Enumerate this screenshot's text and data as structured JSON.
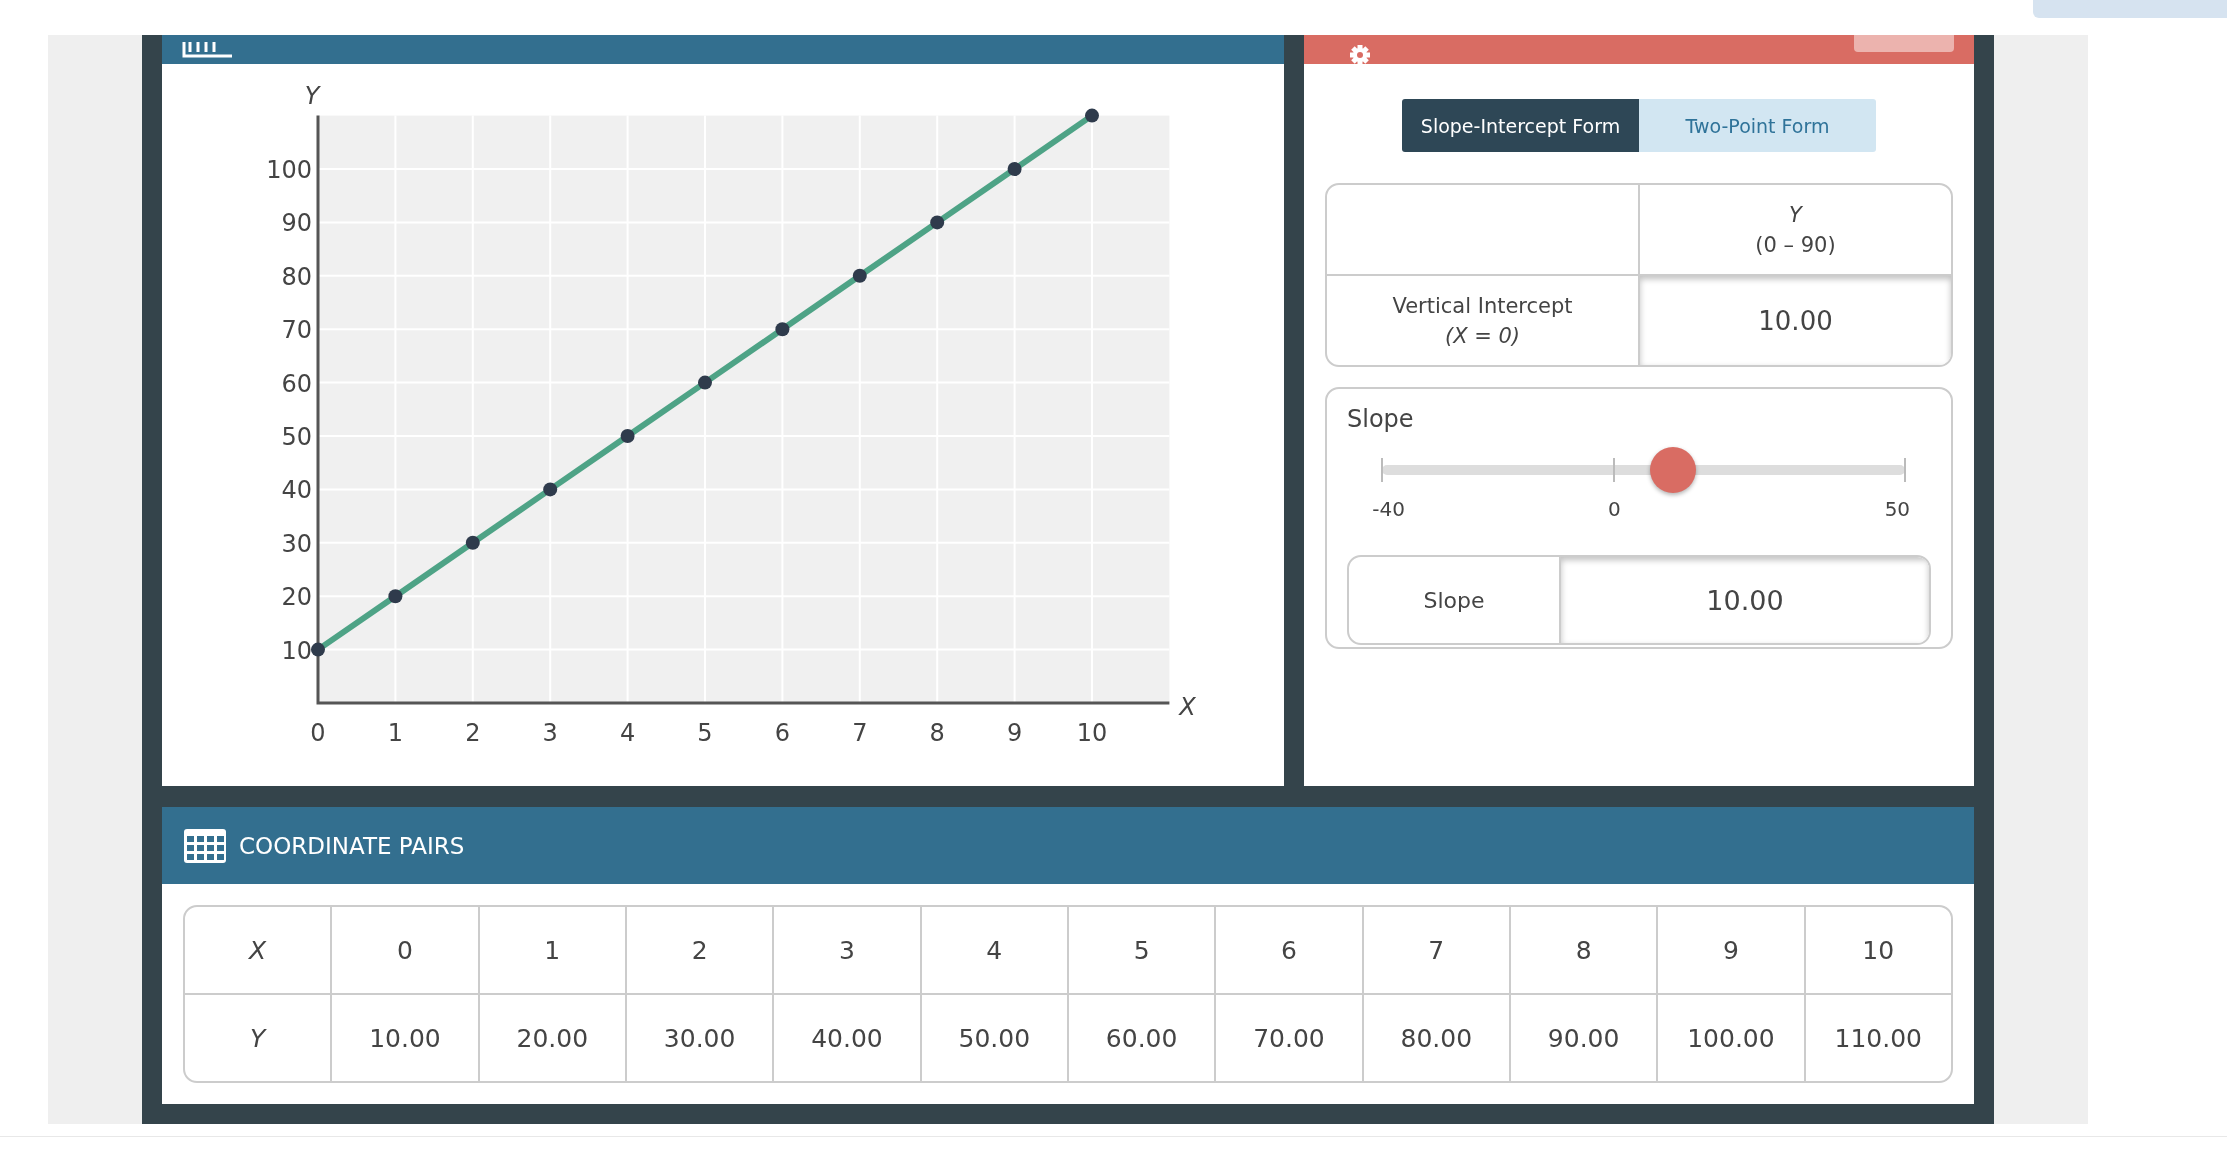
{
  "graph_panel": {
    "chart_data": {
      "type": "line",
      "xlabel": "X",
      "ylabel": "Y",
      "x": [
        0,
        1,
        2,
        3,
        4,
        5,
        6,
        7,
        8,
        9,
        10
      ],
      "grid": true,
      "series": [
        {
          "color": "#4ea386",
          "marker": "circle",
          "values": [
            10,
            20,
            30,
            40,
            50,
            60,
            70,
            80,
            90,
            100,
            110
          ]
        }
      ],
      "xlim": [
        0,
        11
      ],
      "ylim": [
        0,
        110
      ],
      "xticks": [
        0,
        1,
        2,
        3,
        4,
        5,
        6,
        7,
        8,
        9,
        10
      ],
      "yticks": [
        10,
        20,
        30,
        40,
        50,
        60,
        70,
        80,
        90,
        100
      ]
    }
  },
  "form_panel": {
    "tabs": [
      {
        "label": "Slope-Intercept Form",
        "selected": true
      },
      {
        "label": "Two-Point Form",
        "selected": false
      }
    ],
    "intercept_table": {
      "column_header": "Y",
      "column_range": "(0 – 90)",
      "row_label": "Vertical Intercept",
      "row_condition": "(X = 0)",
      "value": "10.00"
    },
    "slope": {
      "title": "Slope",
      "level": 0.556,
      "ticks": [
        "-40",
        "0",
        "50"
      ],
      "field_label": "Slope",
      "value": "10.00"
    }
  },
  "coordinate_pairs": {
    "title": "COORDINATE PAIRS",
    "rows": [
      {
        "label": "X",
        "cells": [
          "0",
          "1",
          "2",
          "3",
          "4",
          "5",
          "6",
          "7",
          "8",
          "9",
          "10"
        ]
      },
      {
        "label": "Y",
        "cells": [
          "10.00",
          "20.00",
          "30.00",
          "40.00",
          "50.00",
          "60.00",
          "70.00",
          "80.00",
          "90.00",
          "100.00",
          "110.00"
        ]
      }
    ]
  }
}
